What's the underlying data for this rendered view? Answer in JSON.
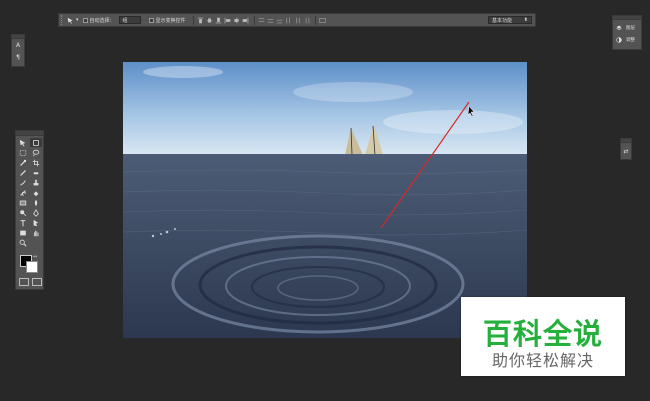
{
  "optionsbar": {
    "auto_select_label": "自动选择：",
    "auto_select_value": "组",
    "show_transform_label": "显示变换控件",
    "workspace_value": "基本功能"
  },
  "right_panel": {
    "items": [
      {
        "label": "图层",
        "icon": "layers-icon"
      },
      {
        "label": "调整",
        "icon": "adjustments-icon"
      }
    ]
  },
  "watermark": {
    "title": "百科全说",
    "subtitle": "助你轻松解决"
  },
  "colors": {
    "workspace_bg": "#282828",
    "panel_bg": "#535353",
    "arrow": "#d42a2a",
    "watermark_green": "#25b03c"
  },
  "tools": [
    "move-tool-icon",
    "artboard-tool-icon",
    "marquee-tool-icon",
    "lasso-tool-icon",
    "quick-select-tool-icon",
    "crop-tool-icon",
    "eyedropper-tool-icon",
    "healing-brush-icon",
    "brush-tool-icon",
    "clone-stamp-icon",
    "history-brush-icon",
    "eraser-tool-icon",
    "gradient-tool-icon",
    "blur-tool-icon",
    "dodge-tool-icon",
    "pen-tool-icon",
    "type-tool-icon",
    "path-select-icon",
    "shape-tool-icon",
    "hand-tool-icon",
    "zoom-tool-icon"
  ]
}
